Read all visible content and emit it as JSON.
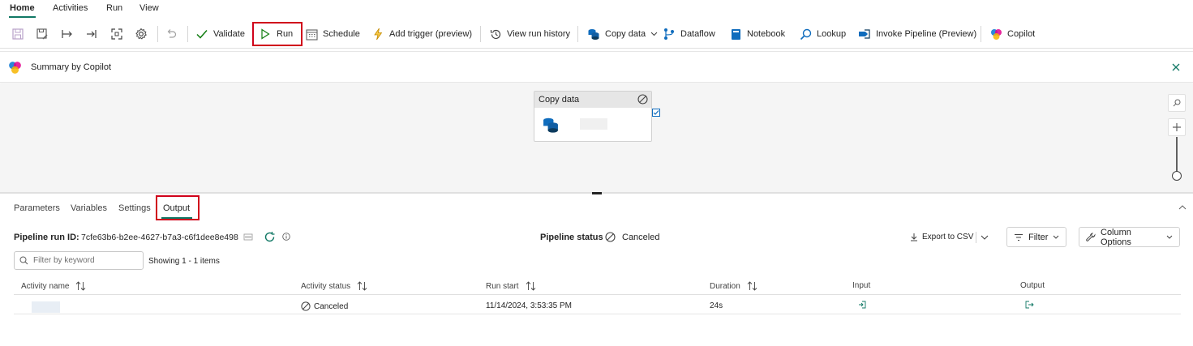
{
  "menu": {
    "tabs": [
      "Home",
      "Activities",
      "Run",
      "View"
    ],
    "active": "Home"
  },
  "toolbar": {
    "validate_label": "Validate",
    "run_label": "Run",
    "schedule_label": "Schedule",
    "add_trigger_label": "Add trigger (preview)",
    "view_run_history_label": "View run history",
    "copy_data_label": "Copy data",
    "dataflow_label": "Dataflow",
    "notebook_label": "Notebook",
    "lookup_label": "Lookup",
    "invoke_pipeline_label": "Invoke Pipeline (Preview)",
    "copilot_label": "Copilot"
  },
  "copilot_bar": {
    "title": "Summary by Copilot"
  },
  "canvas": {
    "activity": {
      "type_label": "Copy data",
      "status": "Canceled"
    }
  },
  "panel": {
    "tabs": [
      "Parameters",
      "Variables",
      "Settings",
      "Output"
    ],
    "active_tab": "Output",
    "pipeline_run_id_label": "Pipeline run ID:",
    "pipeline_run_id": "7cfe63b6-b2ee-4627-b7a3-c6f1dee8e498",
    "pipeline_status_label": "Pipeline status",
    "pipeline_status": "Canceled",
    "export_label": "Export to CSV",
    "filter_label": "Filter",
    "column_options_label": "Column Options",
    "search_placeholder": "Filter by keyword",
    "showing_text": "Showing 1 - 1 items",
    "columns": [
      "Activity name",
      "Activity status",
      "Run start",
      "Duration",
      "Input",
      "Output"
    ],
    "rows": [
      {
        "activity_name": "",
        "activity_status": "Canceled",
        "run_start": "11/14/2024, 3:53:35 PM",
        "duration": "24s"
      }
    ]
  },
  "colors": {
    "accent": "#117865",
    "highlight": "#d0021b",
    "copy_data_blue": "#0f6cbd"
  }
}
